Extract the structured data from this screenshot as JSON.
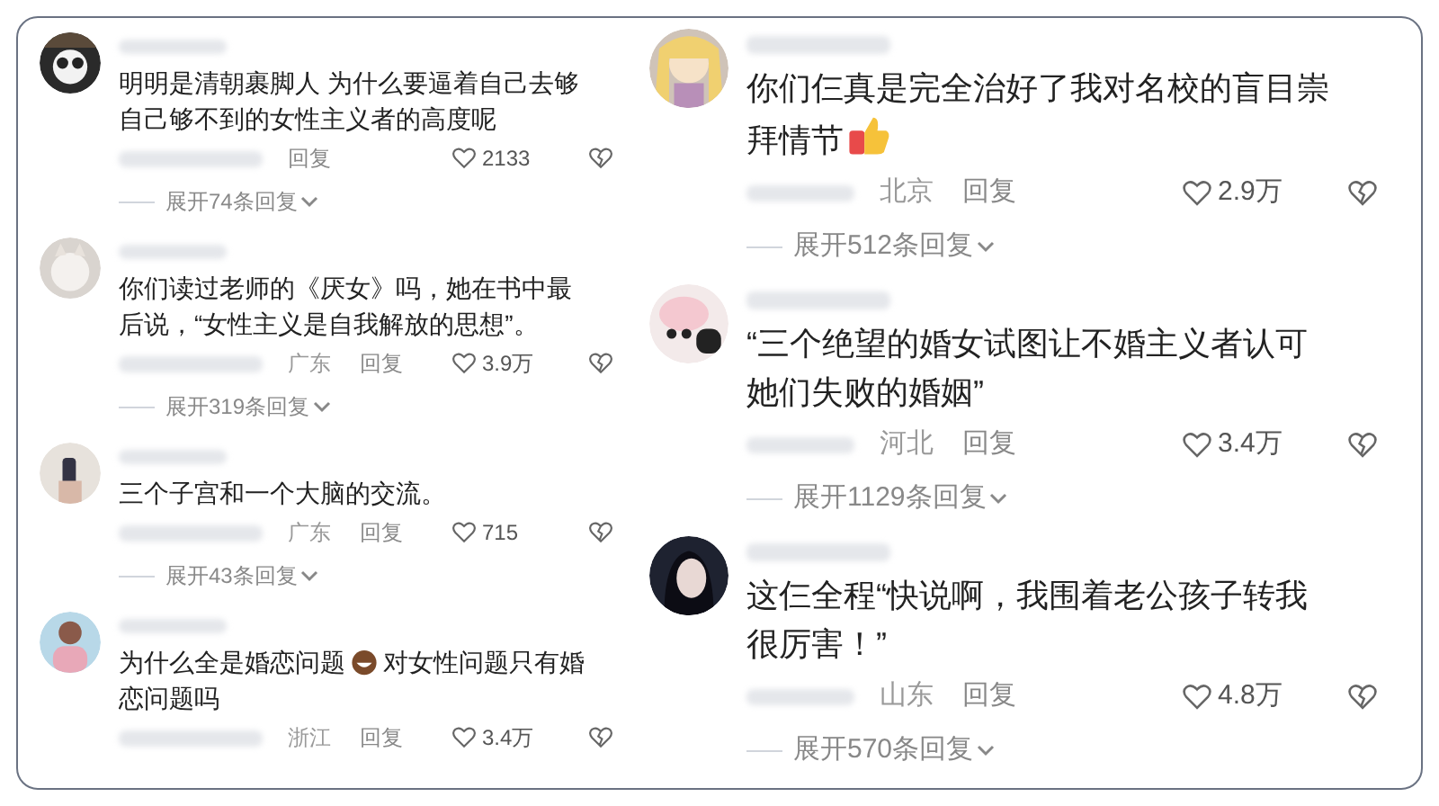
{
  "columns": [
    {
      "comments": [
        {
          "parts": [
            {
              "text": "明明是清朝裹脚人 为什么要逼着自己去够"
            },
            {
              "text": "自己够不到的女性主义者的高度呢"
            }
          ],
          "reply": "回复",
          "likes": "2133",
          "expand": "展开74条回复"
        },
        {
          "parts": [
            {
              "text": "你们读过老师的《厌女》吗，她在书中最"
            },
            {
              "text": "后说，“女性主义是自我解放的思想”。"
            }
          ],
          "region": "广东",
          "reply": "回复",
          "likes": "3.9万",
          "expand": "展开319条回复"
        },
        {
          "parts": [
            {
              "text": "三个子宫和一个大脑的交流。"
            }
          ],
          "region": "广东",
          "reply": "回复",
          "likes": "715",
          "expand": "展开43条回复"
        },
        {
          "parts": [
            {
              "text": "为什么全是婚恋问题"
            },
            {
              "kind": "emoji"
            },
            {
              "text": "对女性问题只有婚"
            },
            {
              "text": "恋问题吗"
            }
          ],
          "region": "浙江",
          "reply": "回复",
          "likes": "3.4万"
        }
      ]
    },
    {
      "comments": [
        {
          "parts": [
            {
              "text": "你们仨真是完全治好了我对名校的盲目崇"
            },
            {
              "text": "拜情节"
            },
            {
              "kind": "emoji"
            }
          ],
          "region": "北京",
          "reply": "回复",
          "likes": "2.9万",
          "expand": "展开512条回复"
        },
        {
          "parts": [
            {
              "text": "“三个绝望的婚女试图让不婚主义者认可"
            },
            {
              "text": "她们失败的婚姻”"
            }
          ],
          "region": "河北",
          "reply": "回复",
          "likes": "3.4万",
          "expand": "展开1129条回复"
        },
        {
          "parts": [
            {
              "text": "这仨全程“快说啊，我围着老公孩子转我"
            },
            {
              "text": "很厉害！”"
            }
          ],
          "region": "山东",
          "reply": "回复",
          "likes": "4.8万",
          "expand": "展开570条回复"
        }
      ]
    }
  ]
}
